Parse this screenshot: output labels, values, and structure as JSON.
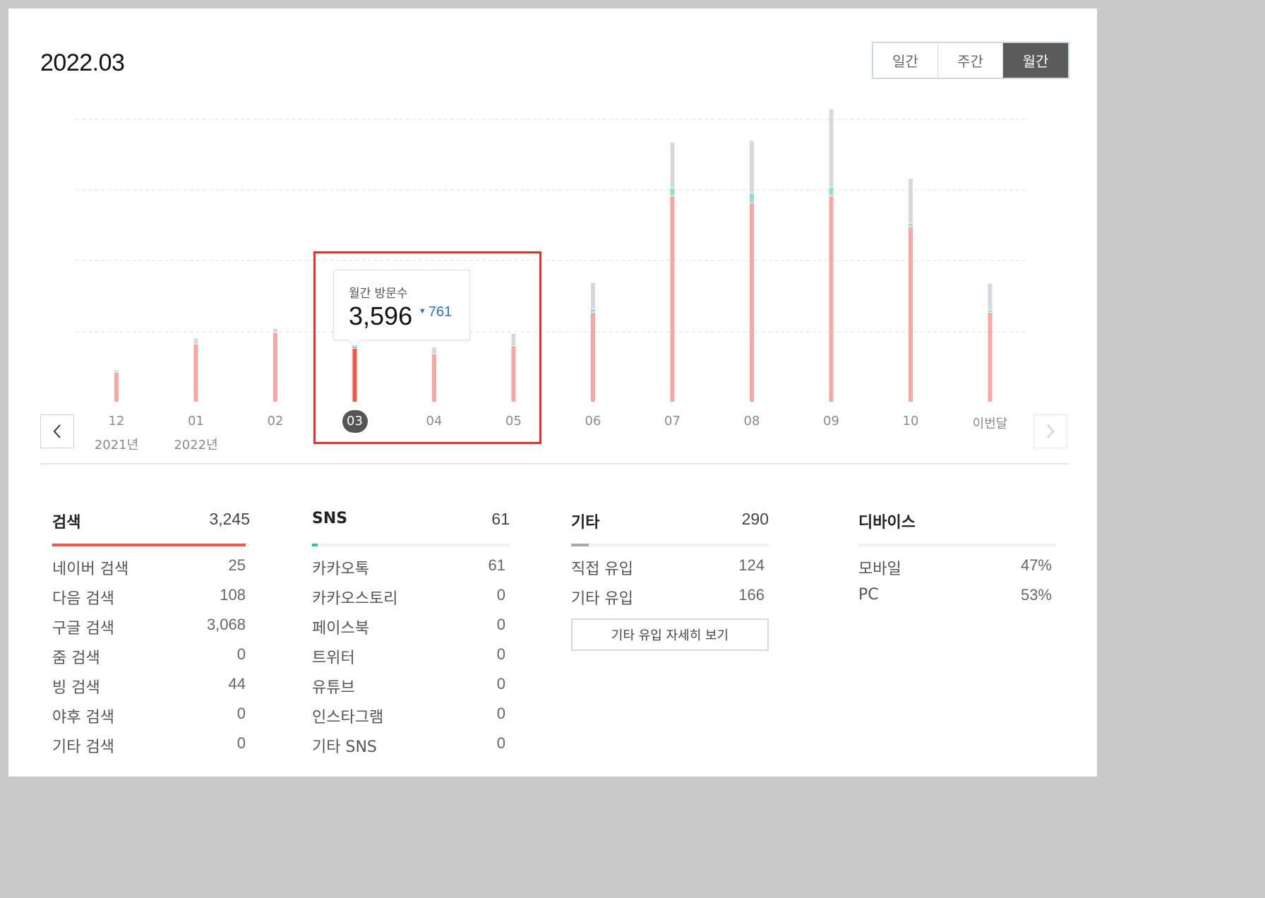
{
  "title": "2022.03",
  "period_tabs": [
    {
      "label": "일간",
      "active": false
    },
    {
      "label": "주간",
      "active": false
    },
    {
      "label": "월간",
      "active": true
    }
  ],
  "chart_data": {
    "type": "bar",
    "stacked": true,
    "categories": [
      "12",
      "01",
      "02",
      "03",
      "04",
      "05",
      "06",
      "07",
      "08",
      "09",
      "10",
      "이번달"
    ],
    "year_labels": {
      "12": "2021년",
      "01": "2022년"
    },
    "selected": "03",
    "series": [
      {
        "color": "#f7a8a3",
        "values": [
          330,
          650,
          780,
          600,
          540,
          630,
          1010,
          2330,
          2250,
          2330,
          1980,
          1010
        ]
      },
      {
        "color": "#8fe0cc",
        "values": [
          0,
          0,
          0,
          0,
          0,
          0,
          30,
          80,
          100,
          90,
          30,
          20
        ]
      },
      {
        "color": "#d5d8dc",
        "values": [
          20,
          60,
          40,
          30,
          70,
          130,
          290,
          510,
          590,
          880,
          500,
          290
        ]
      }
    ],
    "selected_color": "#f15a4a",
    "ylim": [
      0,
      4000
    ],
    "grid": true
  },
  "tooltip": {
    "title": "월간 방문수",
    "value": "3,596",
    "delta": "761",
    "delta_direction": "down"
  },
  "sections": [
    {
      "name": "검색",
      "total": "3,245",
      "fill": 0.98,
      "color": "#f15a4a",
      "rows": [
        {
          "label": "네이버 검색",
          "value": "25"
        },
        {
          "label": "다음 검색",
          "value": "108"
        },
        {
          "label": "구글 검색",
          "value": "3,068"
        },
        {
          "label": "줌 검색",
          "value": "0"
        },
        {
          "label": "빙 검색",
          "value": "44"
        },
        {
          "label": "야후 검색",
          "value": "0"
        },
        {
          "label": "기타 검색",
          "value": "0"
        }
      ]
    },
    {
      "name": "SNS",
      "total": "61",
      "fill": 0.03,
      "color": "#2bc3a5",
      "rows": [
        {
          "label": "카카오톡",
          "value": "61"
        },
        {
          "label": "카카오스토리",
          "value": "0"
        },
        {
          "label": "페이스북",
          "value": "0"
        },
        {
          "label": "트위터",
          "value": "0"
        },
        {
          "label": "유튜브",
          "value": "0"
        },
        {
          "label": "인스타그램",
          "value": "0"
        },
        {
          "label": "기타 SNS",
          "value": "0"
        }
      ]
    },
    {
      "name": "기타",
      "total": "290",
      "fill": 0.09,
      "color": "#a4a9b0",
      "rows": [
        {
          "label": "직접 유입",
          "value": "124"
        },
        {
          "label": "기타 유입",
          "value": "166"
        }
      ],
      "button": "기타 유입 자세히 보기"
    },
    {
      "name": "디바이스",
      "total": "",
      "fill": 0,
      "color": "#cccccc",
      "rows": [
        {
          "label": "모바일",
          "value": "47%"
        },
        {
          "label": "PC",
          "value": "53%"
        }
      ]
    }
  ],
  "icons": {
    "prev": "chevron-left-icon",
    "next": "chevron-right-icon"
  }
}
